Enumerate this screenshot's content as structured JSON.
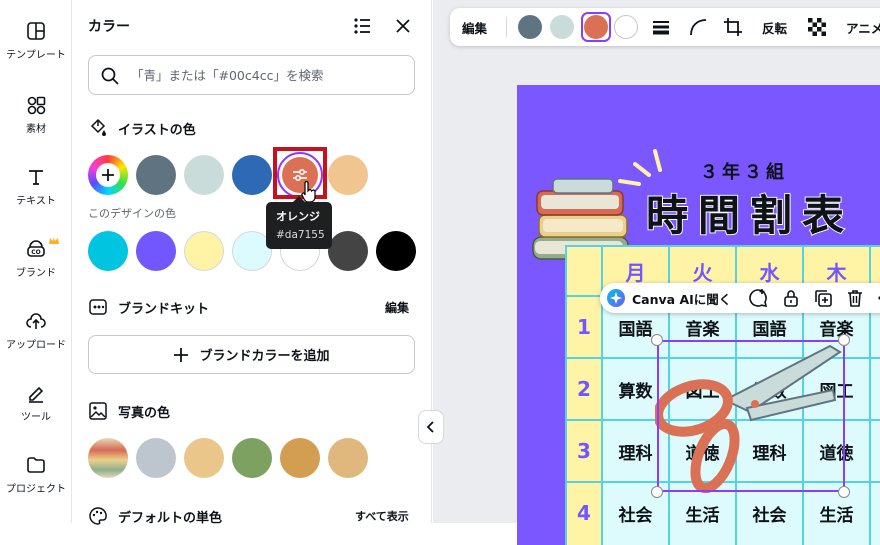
{
  "rail": {
    "items": [
      {
        "label": "テンプレート"
      },
      {
        "label": "素材"
      },
      {
        "label": "テキスト"
      },
      {
        "label": "ブランド"
      },
      {
        "label": "アップロード"
      },
      {
        "label": "ツール"
      },
      {
        "label": "プロジェクト"
      }
    ]
  },
  "panel": {
    "title": "カラー",
    "search_placeholder": "「青」または「#00c4cc」を検索",
    "illustration_section": "イラストの色",
    "design_colors_label": "このデザインの色",
    "brandkit_section": "ブランドキット",
    "brandkit_edit": "編集",
    "brand_add": "ブランドカラーを追加",
    "photo_section": "写真の色",
    "default_section": "デフォルトの単色",
    "show_all": "すべて表示",
    "illustration_colors": [
      "#5f7480",
      "#c9dcda",
      "#2e69b5",
      "#da7155",
      "#f0c58f"
    ],
    "design_colors": [
      "#00c4e0",
      "#7257ff",
      "#fff3a6",
      "#dcfbff",
      "#ffffff",
      "#444444",
      "#000000"
    ],
    "photo_colors": [
      "#bdc6cf",
      "#ebc68b",
      "#7ca161",
      "#d39d52",
      "#e0b77d"
    ],
    "tooltip": {
      "name": "オレンジ",
      "hex": "#da7155"
    }
  },
  "toolbar": {
    "edit": "編集",
    "colors": [
      "#5f7480",
      "#c9dcda",
      "#da7155",
      "#ffffff"
    ],
    "flip": "反転",
    "animate": "アニメ"
  },
  "design": {
    "subtitle": "３年３組",
    "title": "時間割表",
    "days": [
      "月",
      "火",
      "水",
      "木"
    ],
    "periods": [
      "1",
      "2",
      "3",
      "4"
    ],
    "rows": [
      [
        "国語",
        "音楽",
        "国語",
        "音楽"
      ],
      [
        "算数",
        "図工",
        "算数",
        "図工"
      ],
      [
        "理科",
        "道徳",
        "理科",
        "道徳"
      ],
      [
        "社会",
        "生活",
        "社会",
        "生活"
      ]
    ]
  },
  "ai_bar": {
    "label": "Canva AIに聞く"
  }
}
